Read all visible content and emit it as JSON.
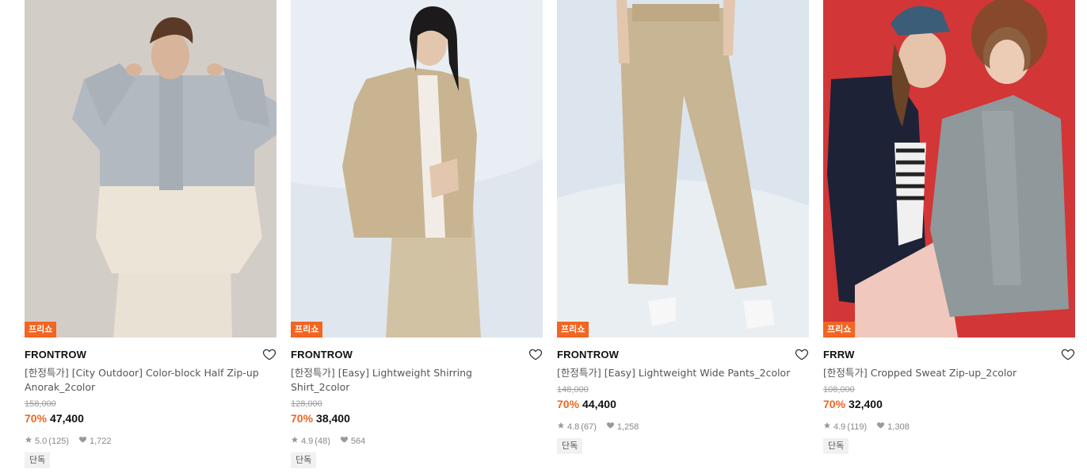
{
  "colors": {
    "accent": "#f26522",
    "badge": "#f26522"
  },
  "products": [
    {
      "badge": "프리쇼",
      "brand": "FRONTROW",
      "title": "[한정특가] [City Outdoor] Color-block Half Zip-up Anorak_2color",
      "original_price": "158,000",
      "discount": "70%",
      "price": "47,400",
      "rating": "5.0",
      "reviews": "(125)",
      "likes": "1,722",
      "tag": "단독",
      "image_desc": "model-gray-beige-anorak"
    },
    {
      "badge": "프리쇼",
      "brand": "FRONTROW",
      "title": "[한정특가] [Easy] Lightweight Shirring Shirt_2color",
      "original_price": "128,000",
      "discount": "70%",
      "price": "38,400",
      "rating": "4.9",
      "reviews": "(48)",
      "likes": "564",
      "tag": "단독",
      "image_desc": "model-beige-shirt"
    },
    {
      "badge": "프리쇼",
      "brand": "FRONTROW",
      "title": "[한정특가] [Easy] Lightweight Wide Pants_2color",
      "original_price": "148,000",
      "discount": "70%",
      "price": "44,400",
      "rating": "4.8",
      "reviews": "(67)",
      "likes": "1,258",
      "tag": "단독",
      "image_desc": "model-beige-wide-pants"
    },
    {
      "badge": "프리쇼",
      "brand": "FRRW",
      "title": "[한정특가] Cropped Sweat Zip-up_2color",
      "original_price": "108,000",
      "discount": "70%",
      "price": "32,400",
      "rating": "4.9",
      "reviews": "(119)",
      "likes": "1,308",
      "tag": "단독",
      "image_desc": "two-models-red-background"
    }
  ]
}
